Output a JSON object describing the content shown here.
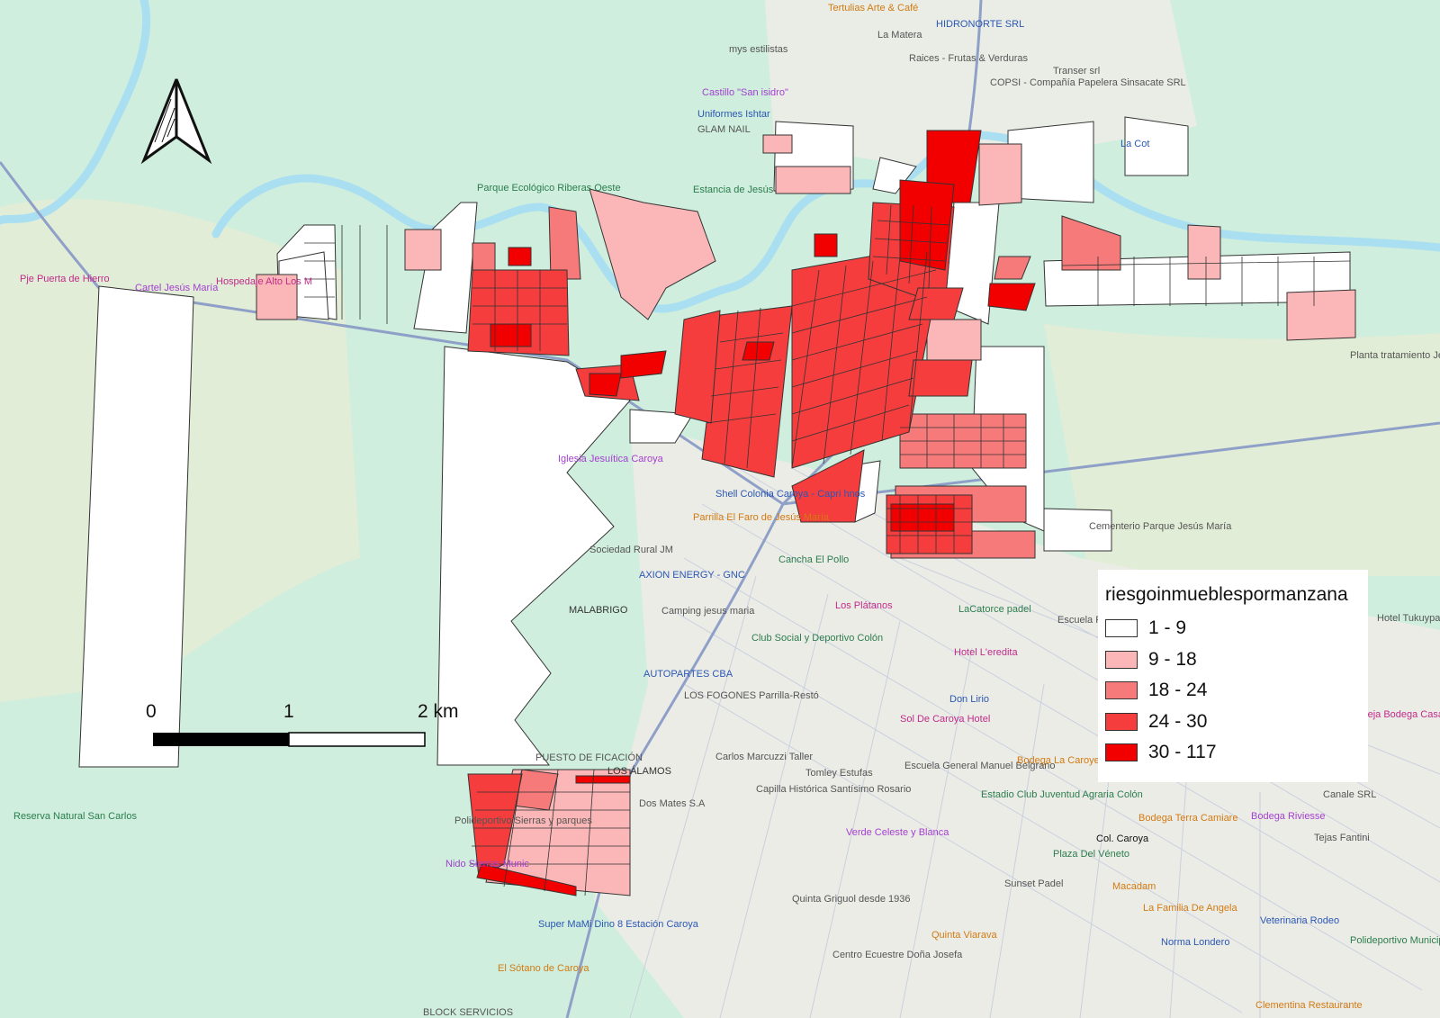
{
  "legend": {
    "title": "riesgoinmueblespormanzana",
    "classes": [
      {
        "label": "1 - 9",
        "color": "#ffffff"
      },
      {
        "label": "9 - 18",
        "color": "#fbb7b7"
      },
      {
        "label": "18 - 24",
        "color": "#f77a7a"
      },
      {
        "label": "24 - 30",
        "color": "#f53d3d"
      },
      {
        "label": "30 - 117",
        "color": "#f20000"
      }
    ]
  },
  "scale_bar": {
    "label_0": "0",
    "label_1": "1",
    "label_2": "2 km"
  },
  "north_arrow": {
    "icon": "north-arrow-icon"
  },
  "colors": {
    "land": "#cfeedd",
    "river": "#aadff1",
    "urban": "#ecece6",
    "road": "#8fa0c8",
    "outline": "#333333"
  },
  "places": [
    {
      "name": "Tertulias Arte & Café"
    },
    {
      "name": "HIDRONORTE SRL"
    },
    {
      "name": "La Matera"
    },
    {
      "name": "mys estilistas"
    },
    {
      "name": "Raices - Frutas & Verduras"
    },
    {
      "name": "Transer srl"
    },
    {
      "name": "COPSI - Compañía Papelera Sinsacate SRL"
    },
    {
      "name": "Castillo \"San isidro\""
    },
    {
      "name": "Uniformes Ishtar"
    },
    {
      "name": "GLAM NAIL"
    },
    {
      "name": "La Cot"
    },
    {
      "name": "Parque Ecológico Riberas Oeste"
    },
    {
      "name": "Estancia de Jesús"
    },
    {
      "name": "Pje Puerta de Hierro"
    },
    {
      "name": "Cartel Jesús María"
    },
    {
      "name": "Hospedaje Alto Los M"
    },
    {
      "name": "Planta tratamiento Jesús María"
    },
    {
      "name": "Iglesia Jesuítica Caroya"
    },
    {
      "name": "Shell Colonia Caroya - Capri hnos"
    },
    {
      "name": "Parrilla El Faro de Jesús María"
    },
    {
      "name": "Cancha El Pollo"
    },
    {
      "name": "Sociedad Rural JM"
    },
    {
      "name": "AXION ENERGY - GNC"
    },
    {
      "name": "MALABRIGO"
    },
    {
      "name": "Camping jesus maria"
    },
    {
      "name": "Los Plátanos"
    },
    {
      "name": "LaCatorce padel"
    },
    {
      "name": "Escuela Pr Colonia Ca"
    },
    {
      "name": "Club Social y Deportivo Colón"
    },
    {
      "name": "Hotel L'eredita"
    },
    {
      "name": "AUTOPARTES CBA"
    },
    {
      "name": "LOS FOGONES Parrilla-Restó"
    },
    {
      "name": "Don Lirio"
    },
    {
      "name": "Sol De Caroya Hotel"
    },
    {
      "name": "Carlos Marcuzzi Taller"
    },
    {
      "name": "LOS ÁLAMOS"
    },
    {
      "name": "Tomley Estufas"
    },
    {
      "name": "Escuela General Manuel Belgrano"
    },
    {
      "name": "Bodega La Caroyense"
    },
    {
      "name": "Capilla Histórica Santísimo Rosario"
    },
    {
      "name": "Estadio Club Juventud Agraria Colón"
    },
    {
      "name": "Dos Mates S.A"
    },
    {
      "name": "Reserva Natural San Carlos"
    },
    {
      "name": "Polideportivo Sierras y parques"
    },
    {
      "name": "Bodega Terra Camiare"
    },
    {
      "name": "Col. Caroya"
    },
    {
      "name": "Verde Celeste y Blanca"
    },
    {
      "name": "Plaza Del Véneto"
    },
    {
      "name": "Sunset Padel"
    },
    {
      "name": "Quinta Griguol desde 1936"
    },
    {
      "name": "Macadam"
    },
    {
      "name": "La Familia De Angela"
    },
    {
      "name": "Veterinaria Rodeo"
    },
    {
      "name": "Super MaMi Dino 8 Estación Caroya"
    },
    {
      "name": "Quinta Viarava"
    },
    {
      "name": "Norma Londero"
    },
    {
      "name": "El Sótano de Caroya"
    },
    {
      "name": "Centro Ecuestre Doña Josefa"
    },
    {
      "name": "Canale SRL"
    },
    {
      "name": "Bodega Riviesse"
    },
    {
      "name": "Tejas Fantini"
    },
    {
      "name": "Polideportivo Municipal Colonia Caroya"
    },
    {
      "name": "Clementina Restaurante"
    },
    {
      "name": "Hotel Tukuypak"
    },
    {
      "name": "Vieja Bodega Casa Campo"
    },
    {
      "name": "Cementerio Parque Jesús María"
    },
    {
      "name": "Nido Sierras Munic"
    },
    {
      "name": "PUESTO DE FICACIÓN"
    },
    {
      "name": "BLOCK SERVICIOS"
    }
  ]
}
